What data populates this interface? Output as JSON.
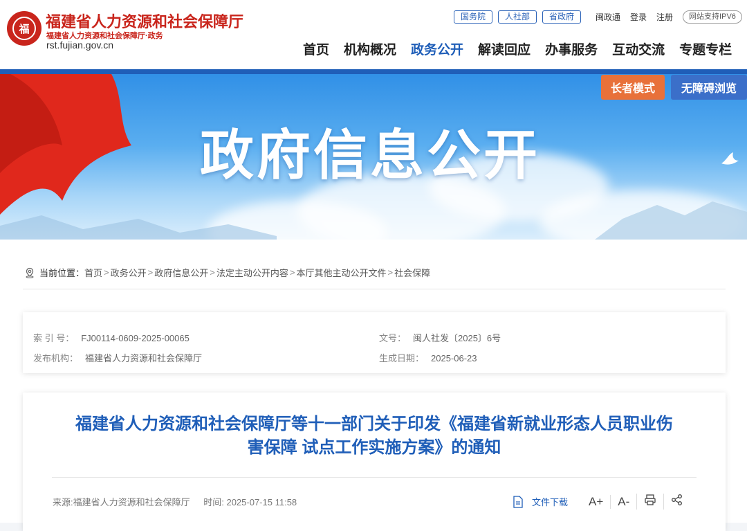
{
  "header": {
    "seal_text": "福",
    "site_name": "福建省人力资源和社会保障厅",
    "site_subtitle": "福建省人力资源和社会保障厅·政务",
    "domain": "rst.fujian.gov.cn",
    "tags": [
      "国务院",
      "人社部",
      "省政府"
    ],
    "links": [
      "闽政通",
      "登录",
      "注册"
    ],
    "ipv6": "网站支持IPV6",
    "nav": [
      "首页",
      "机构概况",
      "政务公开",
      "解读回应",
      "办事服务",
      "互动交流",
      "专题专栏"
    ],
    "nav_active": "政务公开"
  },
  "banner": {
    "title": "政府信息公开",
    "elder_mode": "长者模式",
    "accessible": "无障碍浏览"
  },
  "breadcrumb": {
    "label": "当前位置：",
    "items": [
      "首页",
      "政务公开",
      "政府信息公开",
      "法定主动公开内容",
      "本厅其他主动公开文件",
      "社会保障"
    ]
  },
  "meta": {
    "index_label": "索 引 号：",
    "index_value": "FJ00114-0609-2025-00065",
    "doc_no_label": "文号：",
    "doc_no_value": "闽人社发〔2025〕6号",
    "publisher_label": "发布机构：",
    "publisher_value": "福建省人力资源和社会保障厅",
    "created_label": "生成日期：",
    "created_value": "2025-06-23"
  },
  "article": {
    "title_line1": "福建省人力资源和社会保障厅等十一部门关于印发《福建省新就业形态人员职业伤",
    "title_line2": "害保障 试点工作实施方案》的通知",
    "source": "来源:福建省人力资源和社会保障厅",
    "time": "时间:  2025-07-15 11:58",
    "download": "文件下载",
    "font_up": "A+",
    "font_down": "A-"
  },
  "colors": {
    "brand_red": "#c9251c",
    "brand_blue": "#1f5eb8",
    "elder_orange": "#e8713a",
    "access_blue": "#3b6fc9"
  }
}
